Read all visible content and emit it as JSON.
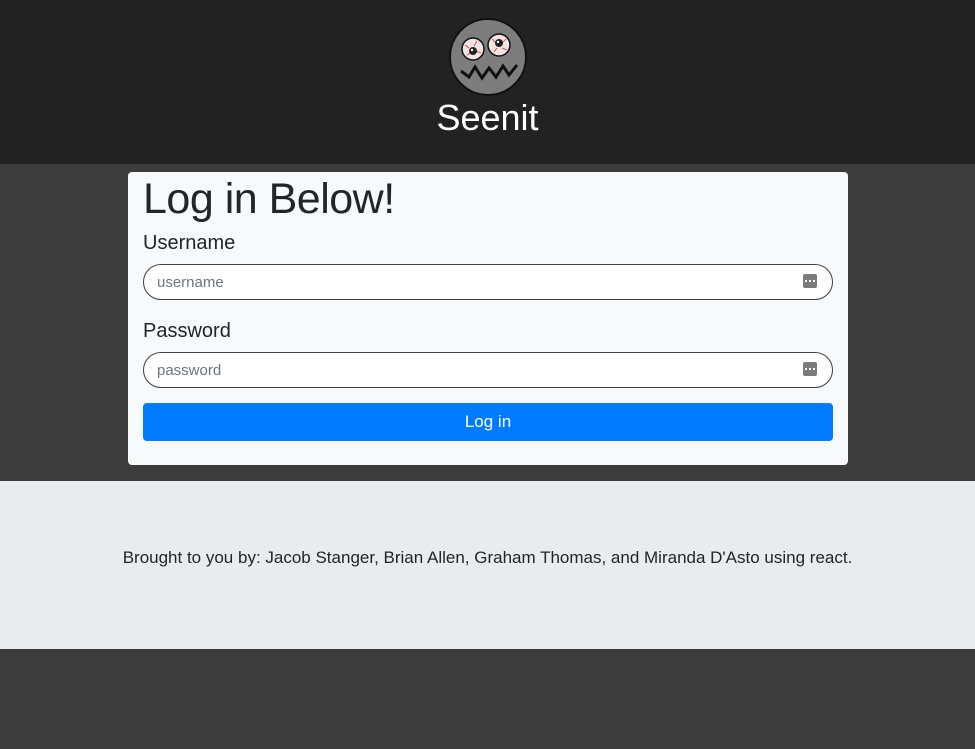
{
  "header": {
    "logo_icon": "zombie-face-logo-icon",
    "site_title": "Seenit"
  },
  "login_card": {
    "title": "Log in Below!",
    "username": {
      "label": "Username",
      "placeholder": "username",
      "value": "",
      "icon": "password-manager-key-icon"
    },
    "password": {
      "label": "Password",
      "placeholder": "password",
      "value": "",
      "icon": "password-manager-key-icon"
    },
    "submit_label": "Log in"
  },
  "footer": {
    "credits": "Brought to you by: Jacob Stanger, Brian Allen, Graham Thomas, and Miranda D'Asto using react."
  },
  "colors": {
    "header_bg": "#222222",
    "page_bg": "#3c3c3c",
    "card_bg": "#f8f9fa",
    "footer_bg": "#e9ecef",
    "button_bg": "#007bff"
  }
}
